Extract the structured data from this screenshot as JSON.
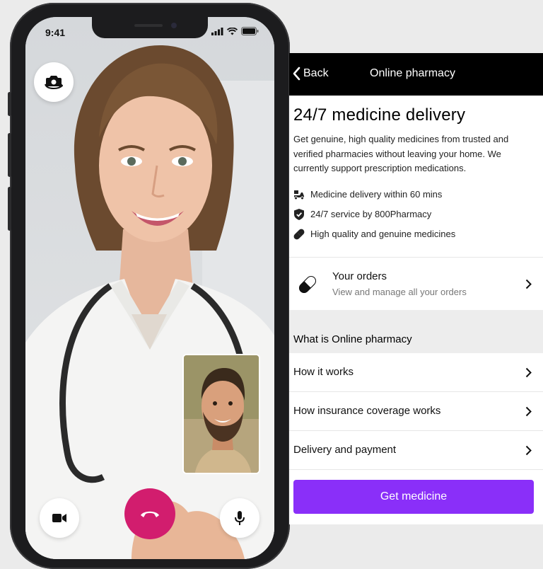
{
  "status_bar": {
    "time": "9:41"
  },
  "call": {
    "flip_camera_icon": "camera-flip-icon",
    "video_icon": "video-camera-icon",
    "end_call_icon": "phone-hangup-icon",
    "mic_icon": "microphone-icon"
  },
  "navbar": {
    "back_label": "Back",
    "title": "Online pharmacy"
  },
  "hero": {
    "title": "24/7 medicine delivery",
    "description": "Get genuine, high quality medicines from trusted and verified pharmacies without leaving your home. We currently support prescription medications."
  },
  "features": [
    {
      "icon": "delivery-scooter-icon",
      "label": "Medicine delivery within 60 mins"
    },
    {
      "icon": "shield-check-icon",
      "label": "24/7 service by 800Pharmacy"
    },
    {
      "icon": "pill-icon",
      "label": "High quality and genuine medicines"
    }
  ],
  "orders": {
    "title": "Your orders",
    "subtitle": "View and manage all your orders"
  },
  "info": {
    "section_title": "What is Online pharmacy",
    "items": [
      {
        "label": "How it works"
      },
      {
        "label": "How insurance coverage works"
      },
      {
        "label": "Delivery and payment"
      }
    ]
  },
  "cta": {
    "label": "Get medicine"
  },
  "colors": {
    "accent": "#8a2ff9",
    "end_call": "#d21d6e",
    "nav_bg": "#000000"
  }
}
